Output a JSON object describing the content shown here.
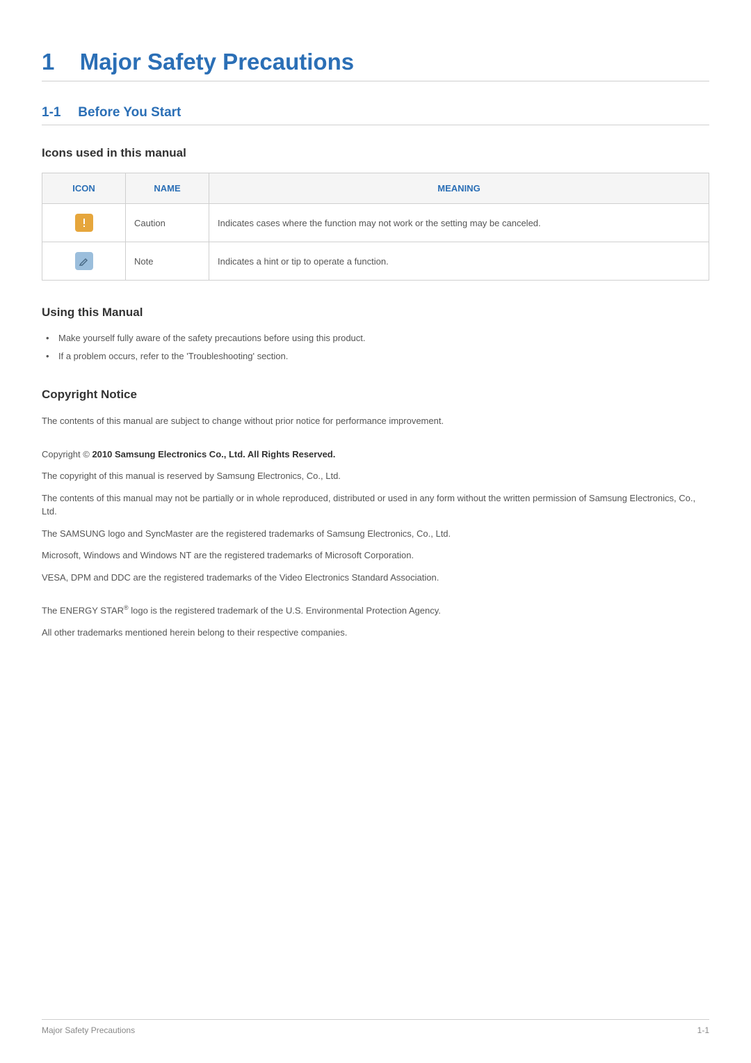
{
  "chapter": {
    "number": "1",
    "title": "Major Safety Precautions"
  },
  "section": {
    "number": "1-1",
    "title": "Before You Start"
  },
  "icons_block": {
    "heading": "Icons used in this manual",
    "table": {
      "headers": {
        "icon": "ICON",
        "name": "NAME",
        "meaning": "MEANING"
      },
      "rows": [
        {
          "icon_name": "caution-icon",
          "name": "Caution",
          "meaning": "Indicates cases where the function may not work or the setting may be canceled."
        },
        {
          "icon_name": "note-icon",
          "name": "Note",
          "meaning": "Indicates a hint or tip to operate a function."
        }
      ]
    }
  },
  "using_manual": {
    "heading": "Using this Manual",
    "bullets": [
      "Make yourself fully aware of the safety precautions before using this product.",
      "If a problem occurs, refer to the 'Troubleshooting' section."
    ]
  },
  "copyright": {
    "heading": "Copyright Notice",
    "intro": "The contents of this manual are subject to change without prior notice for performance improvement.",
    "line_prefix": "Copyright © ",
    "line_bold": "2010 Samsung Electronics Co., Ltd. All Rights Reserved.",
    "paragraphs": [
      "The copyright of this manual is reserved by Samsung Electronics, Co., Ltd.",
      "The contents of this manual may not be partially or in whole reproduced, distributed or used in any form without the written permission of Samsung Electronics, Co., Ltd.",
      "The SAMSUNG logo and SyncMaster are the registered trademarks of Samsung Electronics, Co., Ltd.",
      "Microsoft, Windows and Windows NT are the registered trademarks of Microsoft Corporation.",
      "VESA, DPM and DDC are the registered trademarks of the Video Electronics Standard Association."
    ],
    "energy_star_pre": "The ENERGY STAR",
    "energy_star_sup": "®",
    "energy_star_post": " logo is the registered trademark of the U.S. Environmental Protection Agency.",
    "trailing": "All other trademarks mentioned herein belong to their respective companies."
  },
  "footer": {
    "left": "Major Safety Precautions",
    "right": "1-1"
  }
}
